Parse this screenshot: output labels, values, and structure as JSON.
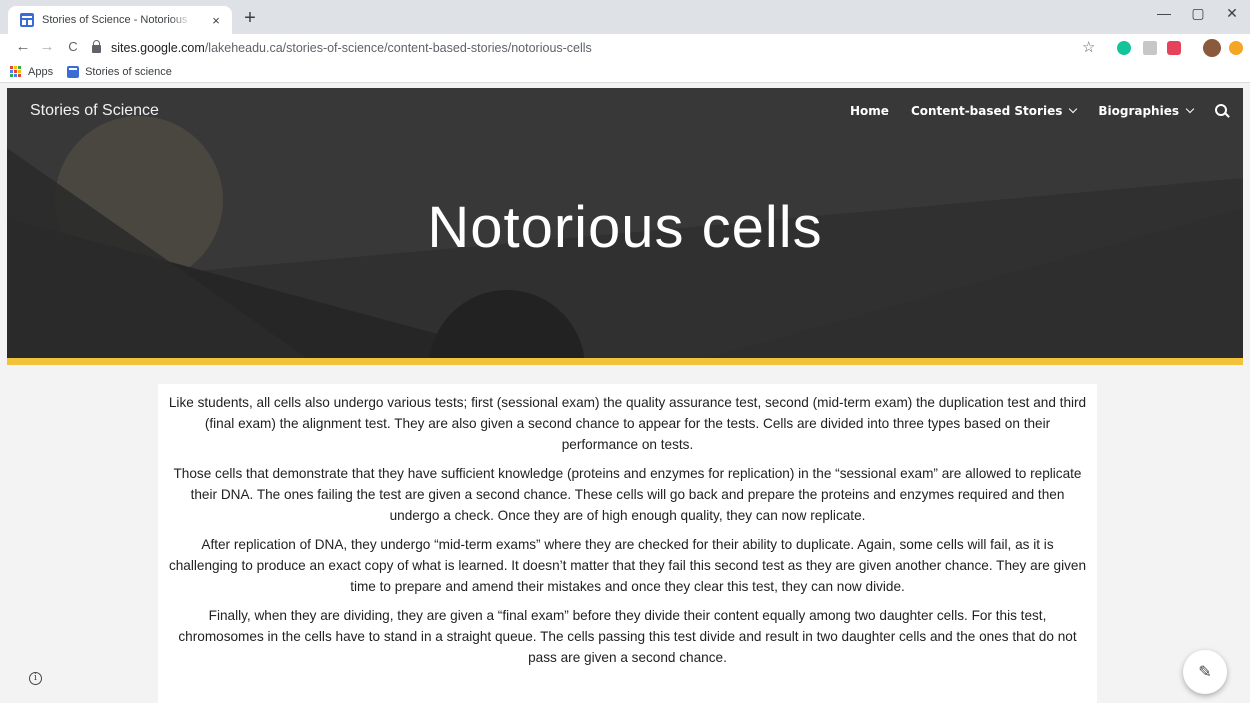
{
  "browser": {
    "tab": {
      "title": "Stories of Science - Notorious cells",
      "favicon": "google-sites-icon",
      "close": "×"
    },
    "new_tab": "+",
    "window_controls": {
      "minimize": "—",
      "maximize": "▢",
      "close": "✕"
    },
    "nav": {
      "back": "←",
      "forward": "→",
      "reload": "C"
    },
    "url": {
      "host": "sites.google.com",
      "path": "/lakeheadu.ca/stories-of-science/content-based-stories/notorious-cells"
    },
    "star": "☆",
    "bookmarks": [
      {
        "label": "Apps",
        "icon": "apps-grid-icon"
      },
      {
        "label": "Stories of science",
        "icon": "google-sites-icon"
      }
    ]
  },
  "site": {
    "title": "Stories of Science",
    "nav": [
      {
        "label": "Home",
        "dropdown": false
      },
      {
        "label": "Content-based Stories",
        "dropdown": true
      },
      {
        "label": "Biographies",
        "dropdown": true
      }
    ],
    "page_heading": "Notorious cells",
    "accent_color": "#f2c33a"
  },
  "content": {
    "paragraphs": [
      "Like students, all cells also undergo various tests; first (sessional exam) the quality assurance test, second (mid-term exam) the duplication test and third (final exam) the alignment test. They are also given a second chance to appear for the tests. Cells are divided into three types based on their performance on tests.",
      "Those cells that demonstrate that they have sufficient knowledge (proteins and enzymes for replication) in the “sessional exam” are allowed to replicate their DNA. The ones failing the test are given a second chance. These cells will go back and prepare the proteins and enzymes required and then undergo a check. Once they are of high enough quality, they can now replicate.",
      "After replication of DNA, they undergo “mid-term exams” where they are checked for their ability to duplicate. Again, some cells will fail, as it is challenging to produce an exact copy of what is learned. It doesn’t matter that they fail this second test as they are given another chance. They are given time to prepare and amend their mistakes and once they clear this test, they can now divide.",
      "Finally, when they are dividing, they are given a “final exam” before they divide their content equally among two daughter cells. For this test, chromosomes in the cells have to stand in a straight queue. The cells passing this test divide and result in two daughter cells and the ones that do not pass are given a second chance."
    ]
  },
  "floating": {
    "info": "i",
    "edit": "✎"
  }
}
